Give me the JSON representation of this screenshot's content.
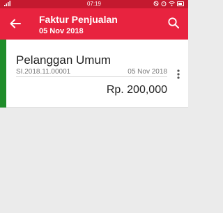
{
  "status_bar": {
    "time": "07:19"
  },
  "app_bar": {
    "title": "Faktur Penjualan",
    "subtitle": "05 Nov 2018"
  },
  "invoice": {
    "customer": "Pelanggan Umum",
    "number": "SI.2018.11.00001",
    "date": "05 Nov 2018",
    "amount": "Rp. 200,000"
  },
  "colors": {
    "status_bar": "#c4192f",
    "app_bar": "#e8233f",
    "accent_green": "#1f8c2a",
    "background": "#ebebeb"
  },
  "icons": {
    "back": "arrow-left-icon",
    "search": "search-icon",
    "more": "more-vertical-icon"
  }
}
